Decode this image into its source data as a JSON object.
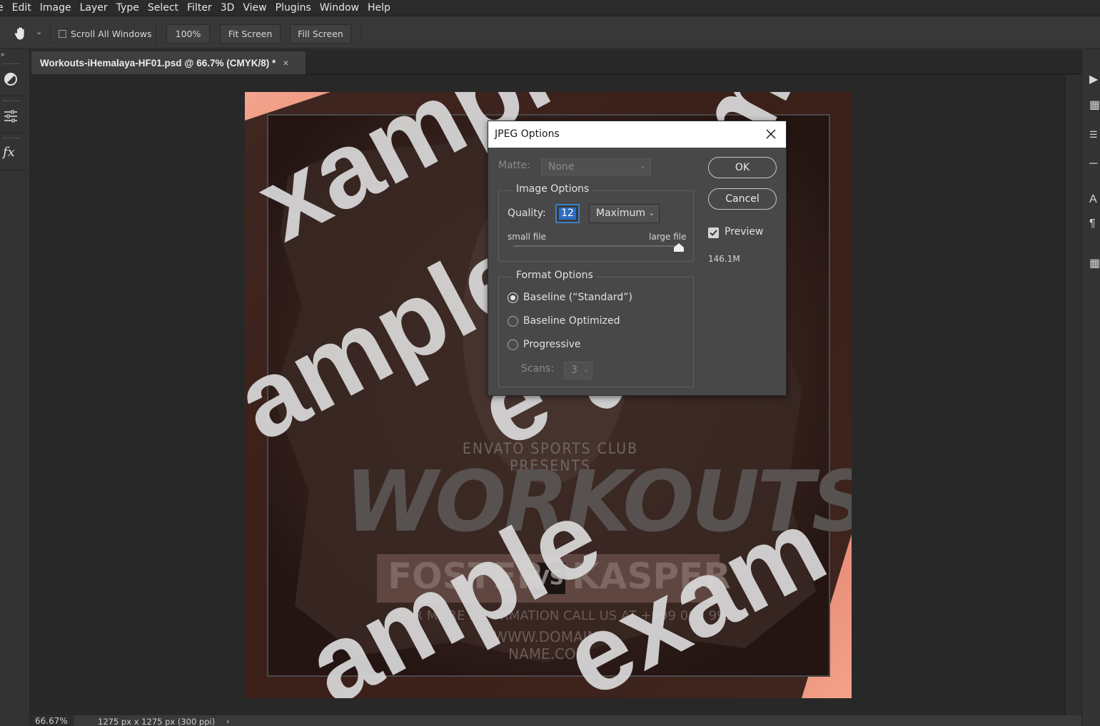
{
  "menubar": {
    "items": [
      "e",
      "Edit",
      "Image",
      "Layer",
      "Type",
      "Select",
      "Filter",
      "3D",
      "View",
      "Plugins",
      "Window",
      "Help"
    ]
  },
  "options_bar": {
    "tool_icon": "hand-icon",
    "scroll_all_label": "Scroll All Windows",
    "scroll_all_checked": false,
    "zoom_100_label": "100%",
    "fit_screen_label": "Fit Screen",
    "fill_screen_label": "Fill Screen"
  },
  "left_toolbar": {
    "icons": [
      "adjustment-circle-icon",
      "sliders-icon",
      "fx-icon"
    ],
    "fx_label": "fx"
  },
  "document": {
    "tab_title": "Workouts-iHemalaya-HF01.psd @ 66.7% (CMYK/8) *",
    "close_glyph": "×"
  },
  "artwork": {
    "presents": "ENVATO SPORTS CLUB PRESENTS",
    "headline": "WORKOUTS",
    "fighter_left": "FOSTER",
    "vs": "VS",
    "fighter_right": "KASPER",
    "info": "FOR MORE INFORMATION CALL US AT +999 000 999",
    "url": "WWW.DOMAIN-NAME.COM",
    "watermarks": [
      "xample",
      "ample",
      "ample",
      "exam",
      "ample",
      "examp",
      "e",
      "ample",
      "exam"
    ],
    "watermark_color": "#d9d9d9"
  },
  "dialog": {
    "title": "JPEG Options",
    "matte_label": "Matte:",
    "matte_value": "None",
    "image_options_legend": "Image Options",
    "quality_label": "Quality:",
    "quality_value": "12",
    "quality_preset": "Maximum",
    "small_file_label": "small file",
    "large_file_label": "large file",
    "quality_slider_fraction": 1.0,
    "format_options_legend": "Format Options",
    "format_options": [
      "Baseline (“Standard”)",
      "Baseline Optimized",
      "Progressive"
    ],
    "format_selected_index": 0,
    "scans_label": "Scans:",
    "scans_value": "3",
    "ok_label": "OK",
    "cancel_label": "Cancel",
    "preview_label": "Preview",
    "preview_checked": true,
    "file_size": "146.1M"
  },
  "status_bar": {
    "zoom": "66.67%",
    "dimensions": "1275 px x 1275 px (300 ppi)",
    "arrow": "›"
  },
  "colors": {
    "app_bg": "#323232",
    "dialog_bg": "#484848",
    "accent_blue": "#2f6cc2",
    "poster_coral": "#e8826a"
  }
}
